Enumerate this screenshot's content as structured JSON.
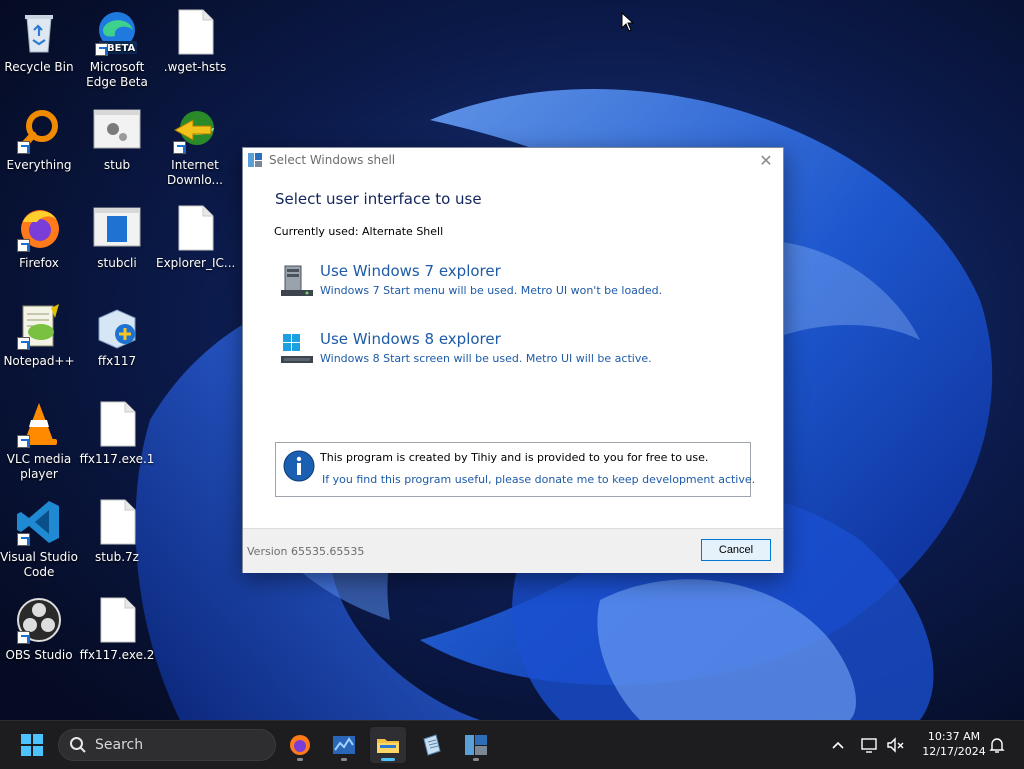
{
  "desktop": {
    "icons": [
      {
        "label": "Recycle Bin"
      },
      {
        "label": "Microsoft Edge Beta",
        "badge": "BETA"
      },
      {
        "label": ".wget-hsts"
      },
      {
        "label": "Everything"
      },
      {
        "label": "stub"
      },
      {
        "label": "Internet Downlo..."
      },
      {
        "label": "Firefox"
      },
      {
        "label": "stubcli"
      },
      {
        "label": "Explorer_IC..."
      },
      {
        "label": "Notepad++"
      },
      {
        "label": "ffx117"
      },
      {
        "label": "VLC media player"
      },
      {
        "label": "ffx117.exe.1"
      },
      {
        "label": "Visual Studio Code"
      },
      {
        "label": "stub.7z"
      },
      {
        "label": "OBS Studio"
      },
      {
        "label": "ffx117.exe.2"
      }
    ]
  },
  "dialog": {
    "title": "Select Windows shell",
    "heading": "Select user interface to use",
    "current": "Currently used: Alternate Shell",
    "options": [
      {
        "title": "Use Windows 7 explorer",
        "desc": "Windows 7 Start menu will be used. Metro UI won't be loaded."
      },
      {
        "title": "Use Windows 8 explorer",
        "desc": "Windows 8 Start screen will be used. Metro UI will be active."
      }
    ],
    "info": {
      "line1": "This program is created by Tihiy and is provided to you for free to use.",
      "line2": "If you find this program useful, please donate me to keep development active."
    },
    "version": "Version 65535.65535",
    "cancel_label": "Cancel"
  },
  "taskbar": {
    "search_placeholder": "Search",
    "time": "10:37 AM",
    "date": "12/17/2024"
  },
  "colors": {
    "link_blue": "#1e5ba8",
    "heading_navy": "#13255a",
    "taskbar_bg": "#1d1d1f",
    "accent": "#0078d7"
  }
}
